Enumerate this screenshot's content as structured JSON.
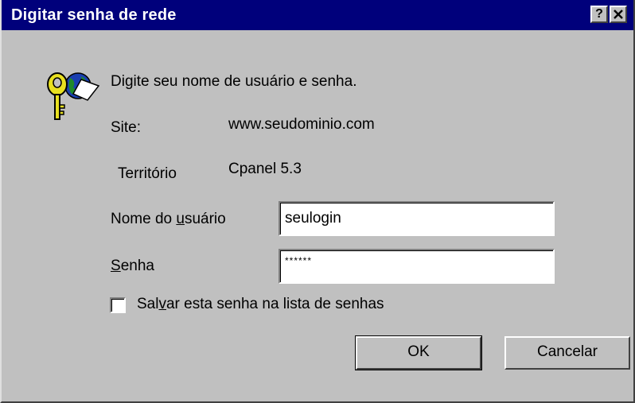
{
  "window": {
    "title": "Digitar senha de rede",
    "help_button": "?",
    "accent_color": "#00007b"
  },
  "dialog": {
    "prompt": "Digite seu nome de usuário e senha.",
    "site_label": "Site:",
    "site_value": "www.seudominio.com",
    "territory_label": "Território",
    "territory_value": "Cpanel 5.3",
    "user_label_pre": "Nome do ",
    "user_label_ul": "u",
    "user_label_post": "suário",
    "user_value": "seulogin",
    "password_label_ul": "S",
    "password_label_post": "enha",
    "password_value": "******",
    "save_label_pre": "Sal",
    "save_label_ul": "v",
    "save_label_post": "ar esta senha na lista de senhas",
    "save_checked": false,
    "ok_label": "OK",
    "cancel_label": "Cancelar"
  },
  "icons": {
    "dialog_icon": "key-globe-icon",
    "close": "close-icon",
    "help": "help-icon"
  }
}
